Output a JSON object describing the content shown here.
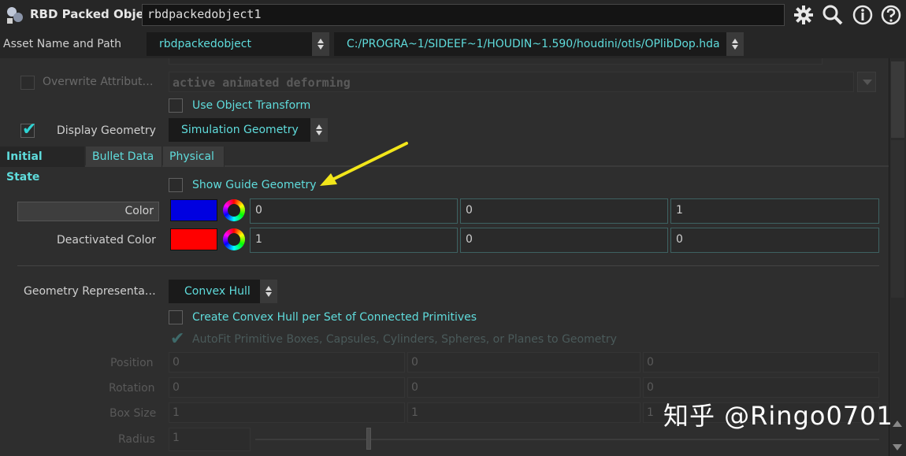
{
  "header": {
    "node_type": "RBD Packed Object",
    "node_name": "rbdpackedobject1"
  },
  "asset": {
    "label": "Asset Name and Path",
    "name": "rbdpackedobject",
    "path": "C:/PROGRA~1/SIDEEF~1/HOUDIN~1.590/houdini/otls/OPlibDop.hda"
  },
  "top_params": {
    "overwrite_label": "Overwrite Attribut…",
    "overwrite_value": "active animated deforming",
    "use_object_transform": "Use Object Transform",
    "display_geometry_label": "Display Geometry",
    "display_geometry_value": "Simulation Geometry"
  },
  "tabs": [
    "Initial State",
    "Bullet Data",
    "Physical"
  ],
  "guide": {
    "show_guide_geometry": "Show Guide Geometry",
    "color_label": "Color",
    "color": [
      "0",
      "0",
      "1"
    ],
    "deactivated_label": "Deactivated Color",
    "deactivated_color": [
      "1",
      "0",
      "0"
    ]
  },
  "colors": {
    "color_swatch": "#0000e0",
    "deactivated_swatch": "#ff0000",
    "accent": "#5fdcdc",
    "annotation_arrow": "#f2e61a"
  },
  "geometry": {
    "representation_label": "Geometry Representa…",
    "representation_value": "Convex Hull",
    "convex_per_set": "Create Convex Hull per Set of Connected Primitives",
    "autofit": "AutoFit Primitive Boxes, Capsules, Cylinders, Spheres, or Planes to Geometry",
    "position_label": "Position",
    "position": [
      "0",
      "0",
      "0"
    ],
    "rotation_label": "Rotation",
    "rotation": [
      "0",
      "0",
      "0"
    ],
    "box_size_label": "Box Size",
    "box_size": [
      "1",
      "1",
      "1"
    ],
    "radius_label": "Radius",
    "radius": "1"
  },
  "watermark": "知乎 @Ringo0701"
}
